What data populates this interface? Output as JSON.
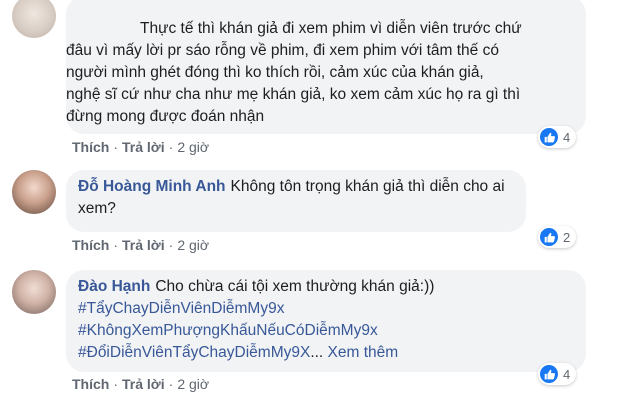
{
  "comments": [
    {
      "author": "",
      "lines": [
        "Thực tế thì khán giả đi xem phim vì diễn viên trước chứ",
        "đâu vì mấy lời pr sáo rỗng về phim, đi xem phim với tâm thế có",
        "người mình ghét đóng thì ko thích rồi, cảm xúc của khán giả,",
        "nghệ sĩ cứ như cha như mẹ khán giả, ko xem cảm xúc họ ra gì thì",
        "đừng mong được đoán nhận"
      ],
      "like_label": "Thích",
      "reply_label": "Trả lời",
      "time": "2 giờ",
      "reaction_count": "4"
    },
    {
      "author": "Đỗ Hoàng Minh Anh",
      "text": "Không tôn trọng khán giả thì diễn cho ai xem?",
      "like_label": "Thích",
      "reply_label": "Trả lời",
      "time": "2 giờ",
      "reaction_count": "2"
    },
    {
      "author": "Đào Hạnh",
      "text": "Cho chừa cái tội xem thường khán giả:))",
      "hashtags": [
        "#TẩyChayDiễnViênDiễmMy9x",
        "#KhôngXemPhượngKhấuNếuCóDiễmMy9x",
        "#ĐổiDiễnViênTẩyChayDiễmMy9X"
      ],
      "ellipsis": "...",
      "see_more": "Xem thêm",
      "like_label": "Thích",
      "reply_label": "Trả lời",
      "time": "2 giờ",
      "reaction_count": "4"
    }
  ],
  "separator": "·",
  "icons": {
    "reaction": "like-icon"
  },
  "colors": {
    "link": "#385898",
    "bubble": "#f2f3f5",
    "meta": "#606770",
    "like_blue": "#1877f2"
  }
}
